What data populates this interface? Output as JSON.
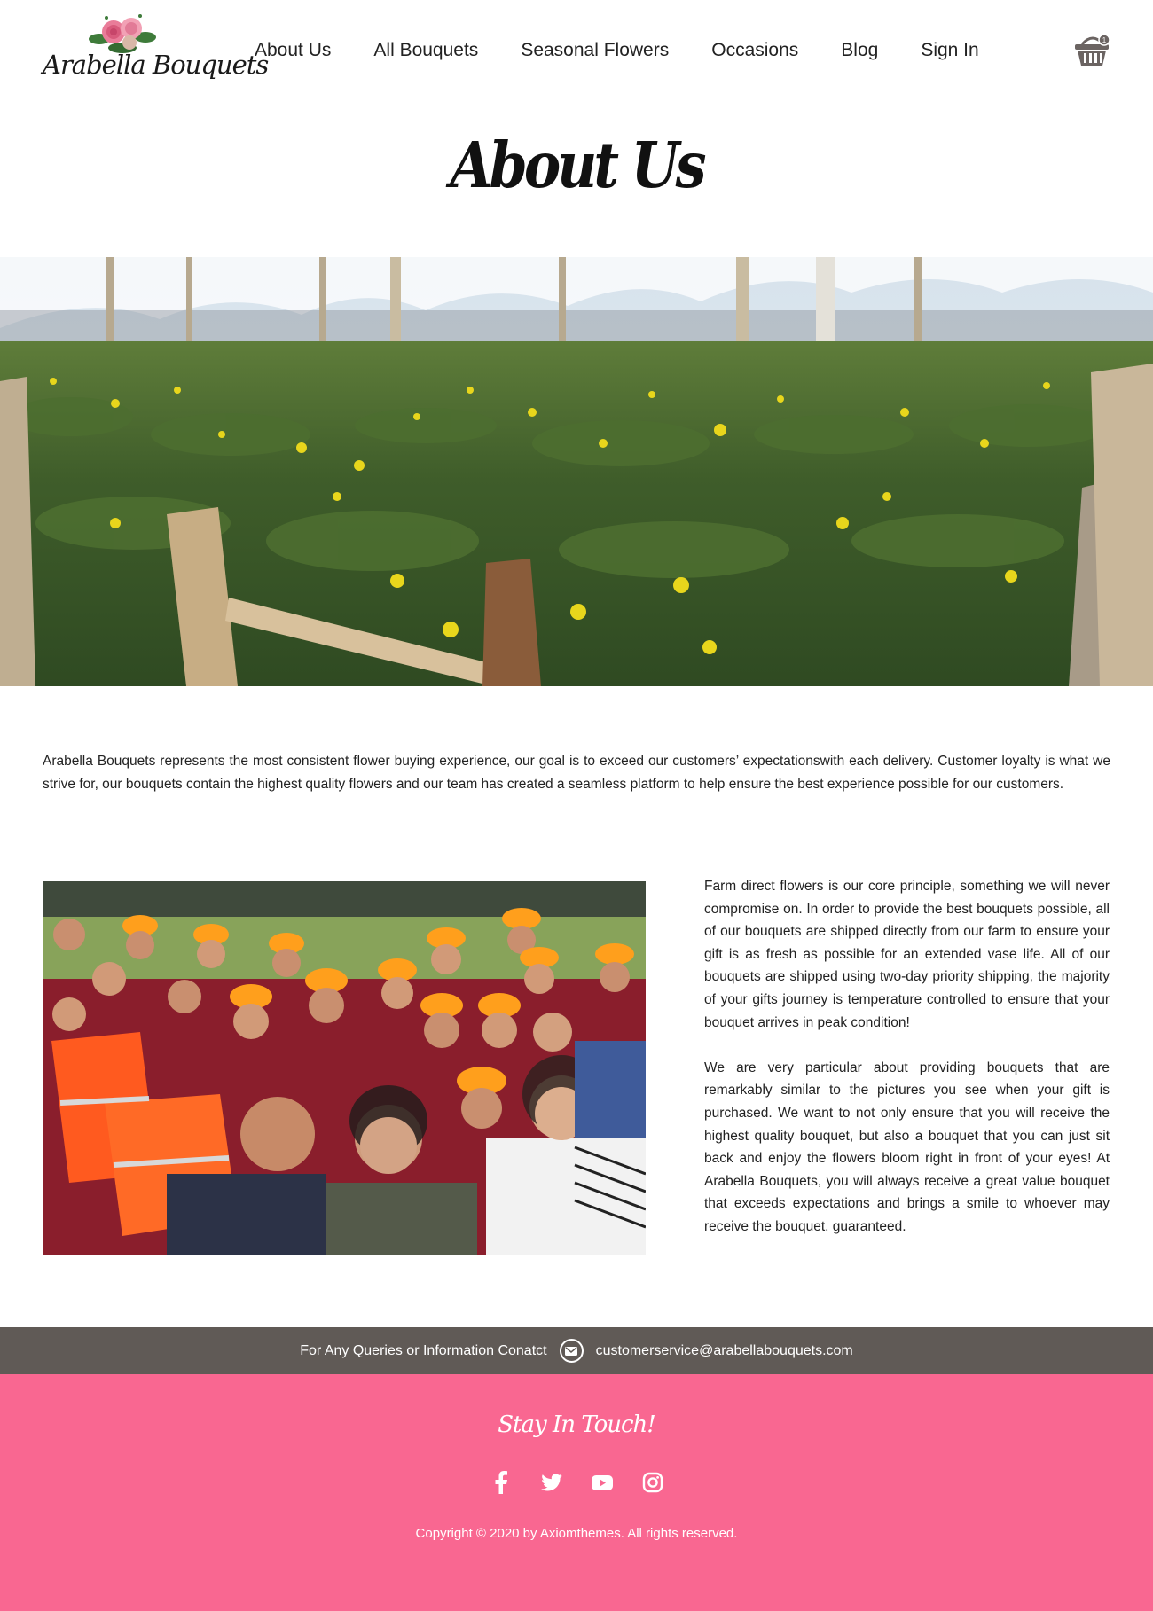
{
  "header": {
    "logo_text": "Arabella Bouquets",
    "nav": [
      "About Us",
      "All Bouquets",
      "Seasonal Flowers",
      "Occasions",
      "Blog",
      "Sign In"
    ],
    "cart_count": "1"
  },
  "page": {
    "title": "About Us"
  },
  "content": {
    "intro": "Arabella Bouquets represents the most consistent flower buying experience, our goal is to exceed our customers’ expectationswith each delivery. Customer loyalty is what we strive for, our bouquets contain the highest quality flowers and our team has created a seamless platform to help ensure the best experience possible for our customers.",
    "paragraph_1": "Farm direct flowers is our core principle, something we will never compromise on. In order to provide the best bouquets possible, all of our bouquets are shipped directly from our farm to ensure your gift is as fresh as possible for an extended vase life. All of our bouquets are shipped using two-day priority shipping, the majority of your gifts journey is temperature controlled to ensure that your bouquet arrives in peak condition!",
    "paragraph_2": "We are very particular about providing bouquets that are remarkably similar to the pictures you see when your gift is purchased. We want to not only ensure that you will receive the highest quality bouquet, but also a bouquet that you can just sit back and enjoy the flowers bloom right in front of your eyes! At Arabella Bouquets, you will always receive a great value bouquet that exceeds expectations and brings a smile to whoever may receive the bouquet, guaranteed."
  },
  "contact": {
    "label": "For Any Queries or Information Conatct",
    "email": "customerservice@arabellabouquets.com"
  },
  "footer": {
    "stay_in_touch": "Stay In Touch!",
    "social_icons": [
      "facebook-icon",
      "twitter-icon",
      "youtube-icon",
      "instagram-icon"
    ],
    "copyright": "Copyright © 2020 by Axiomthemes. All rights reserved."
  },
  "colors": {
    "footer_pink": "#f96791",
    "contact_bar": "#605a56",
    "cap_orange": "#ff9f1c",
    "vest_orange": "#ff5a1f"
  }
}
